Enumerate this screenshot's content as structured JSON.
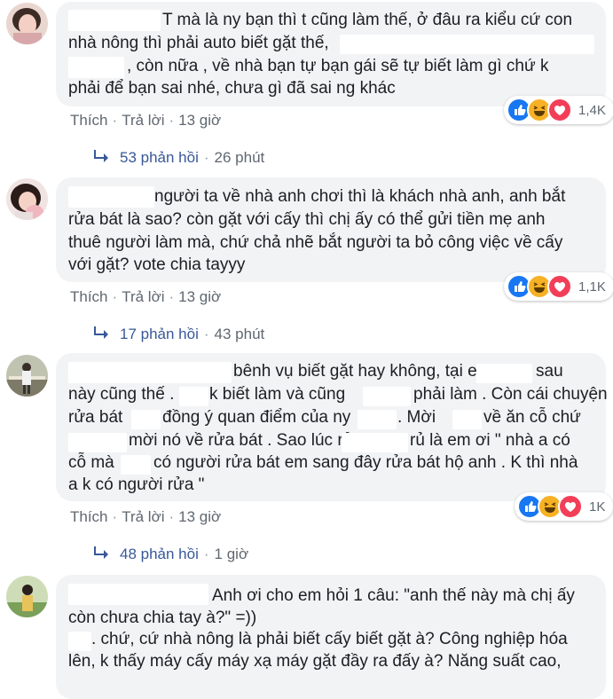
{
  "comments": [
    {
      "lines": [
        "T mà là ny bạn thì t cũng làm thế, ở đâu ra kiểu cứ con",
        "nhà nông thì phải auto biết gặt thế,",
        ", còn nữa , về nhà bạn tự bạn gái sẽ tự biết làm gì chứ k",
        "phải để bạn sai nhé, chưa gì đã sai ng khác"
      ],
      "like_label": "Thích",
      "reply_label": "Trả lời",
      "time": "13 giờ",
      "reaction_count": "1,4K",
      "replies_count": "53 phản hồi",
      "replies_time": "26 phút"
    },
    {
      "lines": [
        "người ta về nhà anh chơi thì là khách nhà anh, anh bắt",
        "rửa bát là sao? còn gặt với cấy thì chị ấy có thể gửi tiền mẹ anh",
        "thuê người làm mà, chứ chả nhẽ bắt người ta bỏ công việc về cấy",
        "với gặt? vote chia tayyy"
      ],
      "like_label": "Thích",
      "reply_label": "Trả lời",
      "time": "13 giờ",
      "reaction_count": "1,1K",
      "replies_count": "17 phản hồi",
      "replies_time": "43 phút"
    },
    {
      "lines": [
        "bênh vụ biết gặt hay không, tại em gái",
        "sau",
        "này cũng thế .",
        "k biết làm và cũng",
        "phải làm . Còn cái chuyện",
        "rửa bát",
        "đồng ý quan điểm của ny",
        ". Mời",
        "về ăn cỗ chứ",
        "mời nó về rửa bát . Sao lúc rủ",
        "rủ là em ơi \" nhà a có",
        "cỗ mà",
        "có người rửa bát em sang đây rửa bát hộ anh . K thì nhà",
        "a k có người rửa \""
      ],
      "like_label": "Thích",
      "reply_label": "Trả lời",
      "time": "13 giờ",
      "reaction_count": "1K",
      "replies_count": "48 phản hồi",
      "replies_time": "1 giờ"
    },
    {
      "lines": [
        "Anh ơi cho em hỏi 1 câu: \"anh thế này mà chị ấy",
        "còn chưa chia tay à?\" =))",
        ". chứ, cứ nhà nông là phải biết cấy biết gặt à? Công nghiệp hóa",
        "lên, k thấy máy cấy máy xạ máy gặt đầy ra đấy à? Năng suất cao,"
      ]
    }
  ],
  "colors": {
    "bubble": "#f2f3f5",
    "link": "#385898",
    "meta": "#606770",
    "like": "#1877f2",
    "haha": "#f7b125",
    "love": "#f33e58"
  },
  "icons": [
    "like-reaction-icon",
    "haha-reaction-icon",
    "love-reaction-icon",
    "reply-arrow-icon"
  ]
}
